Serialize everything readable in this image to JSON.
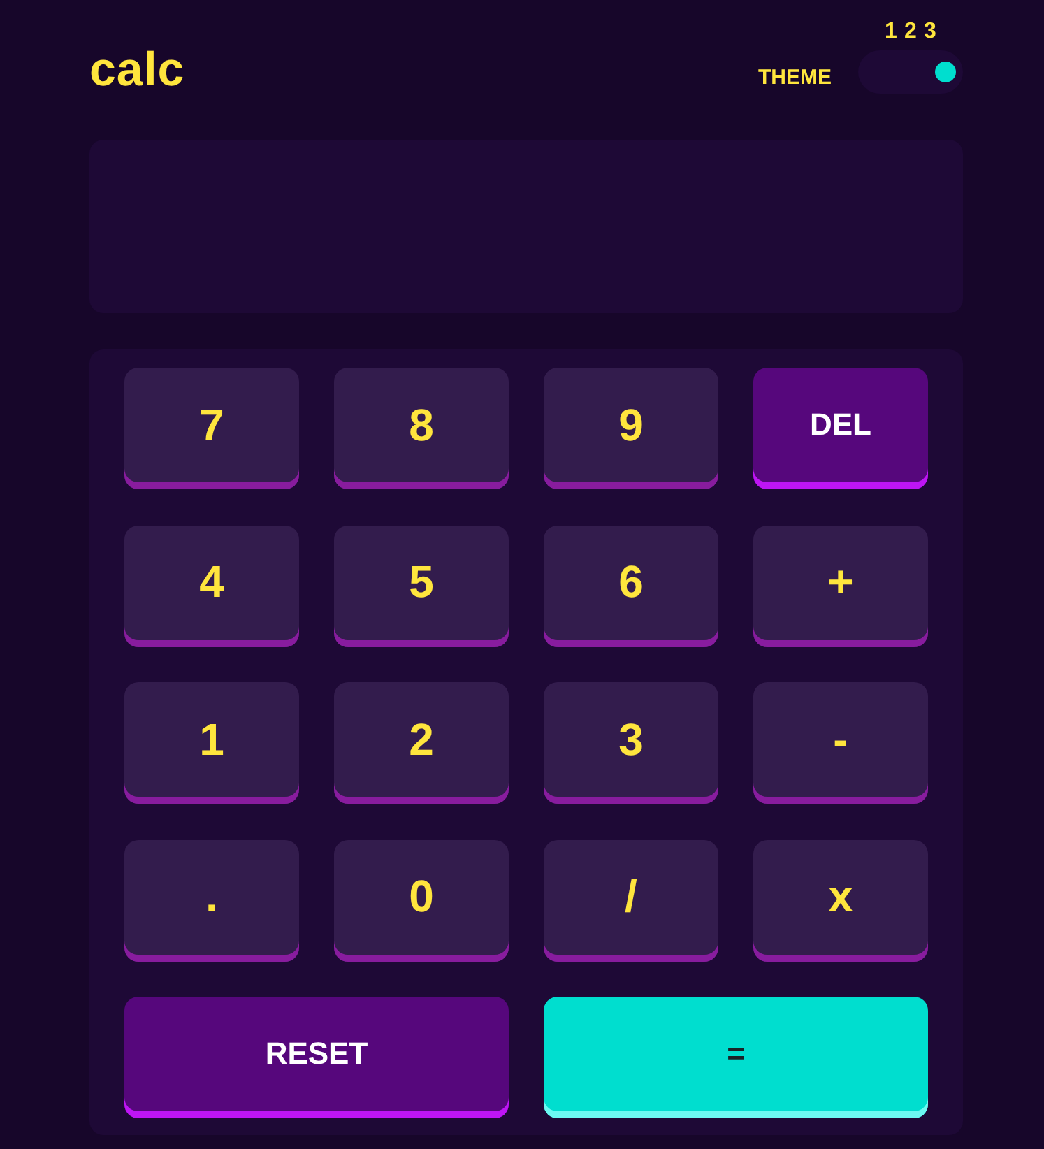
{
  "header": {
    "logo": "calc",
    "theme": {
      "label": "THEME",
      "options": [
        {
          "label": "1",
          "selected": false
        },
        {
          "label": "2",
          "selected": false
        },
        {
          "label": "3",
          "selected": true
        }
      ]
    }
  },
  "keypad": {
    "keys": [
      {
        "label": "7",
        "kind": "digit"
      },
      {
        "label": "8",
        "kind": "digit"
      },
      {
        "label": "9",
        "kind": "digit"
      },
      {
        "label": "DEL",
        "kind": "delete"
      },
      {
        "label": "4",
        "kind": "digit"
      },
      {
        "label": "5",
        "kind": "digit"
      },
      {
        "label": "6",
        "kind": "digit"
      },
      {
        "label": "+",
        "kind": "operator"
      },
      {
        "label": "1",
        "kind": "digit"
      },
      {
        "label": "2",
        "kind": "digit"
      },
      {
        "label": "3",
        "kind": "digit"
      },
      {
        "label": "-",
        "kind": "operator"
      },
      {
        "label": ".",
        "kind": "decimal"
      },
      {
        "label": "0",
        "kind": "digit"
      },
      {
        "label": "/",
        "kind": "operator"
      },
      {
        "label": "x",
        "kind": "operator"
      },
      {
        "label": "RESET",
        "kind": "reset"
      },
      {
        "label": "=",
        "kind": "equals"
      }
    ]
  }
}
